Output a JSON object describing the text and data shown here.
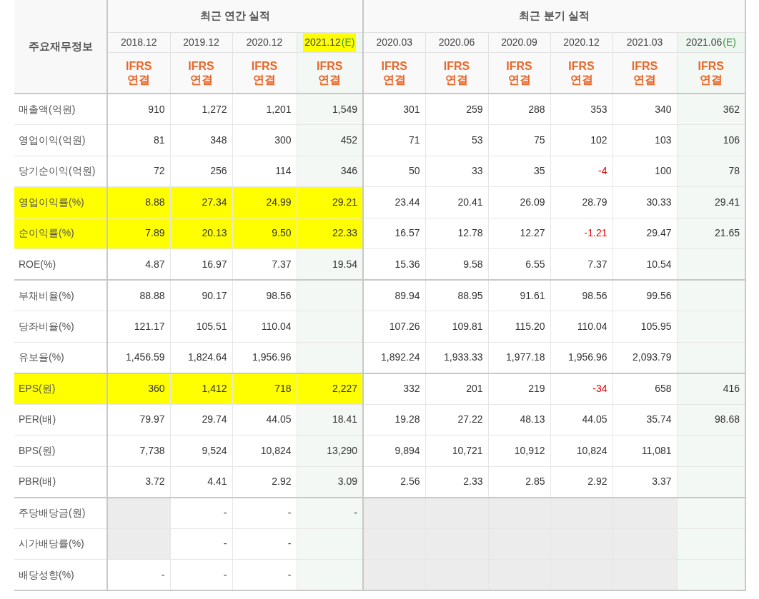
{
  "label_header": "주요재무정보",
  "groups": [
    {
      "title": "최근 연간 실적",
      "columns": [
        {
          "period": "2018.12",
          "highlighted": false,
          "basis": [
            "IFRS",
            "연결"
          ]
        },
        {
          "period": "2019.12",
          "highlighted": false,
          "basis": [
            "IFRS",
            "연결"
          ]
        },
        {
          "period": "2020.12",
          "highlighted": false,
          "basis": [
            "IFRS",
            "연결"
          ]
        },
        {
          "period": "2021.12",
          "estimate_mark": "(E)",
          "highlighted": true,
          "basis": [
            "IFRS",
            "연결"
          ]
        }
      ]
    },
    {
      "title": "최근 분기 실적",
      "columns": [
        {
          "period": "2020.03",
          "highlighted": false,
          "basis": [
            "IFRS",
            "연결"
          ]
        },
        {
          "period": "2020.06",
          "highlighted": false,
          "basis": [
            "IFRS",
            "연결"
          ]
        },
        {
          "period": "2020.09",
          "highlighted": false,
          "basis": [
            "IFRS",
            "연결"
          ]
        },
        {
          "period": "2020.12",
          "highlighted": false,
          "basis": [
            "IFRS",
            "연결"
          ]
        },
        {
          "period": "2021.03",
          "highlighted": false,
          "basis": [
            "IFRS",
            "연결"
          ]
        },
        {
          "period": "2021.06",
          "estimate_mark": "(E)",
          "highlighted": false,
          "basis": [
            "IFRS",
            "연결"
          ]
        }
      ]
    }
  ],
  "rows": [
    {
      "label": "매출액(억원)",
      "highlighted": false,
      "section_end": false,
      "values": [
        "910",
        "1,272",
        "1,201",
        "1,549",
        "301",
        "259",
        "288",
        "353",
        "340",
        "362"
      ]
    },
    {
      "label": "영업이익(억원)",
      "highlighted": false,
      "section_end": false,
      "values": [
        "81",
        "348",
        "300",
        "452",
        "71",
        "53",
        "75",
        "102",
        "103",
        "106"
      ]
    },
    {
      "label": "당기순이익(억원)",
      "highlighted": false,
      "section_end": false,
      "values": [
        "72",
        "256",
        "114",
        "346",
        "50",
        "33",
        "35",
        {
          "text": "-4",
          "negative": true
        },
        "100",
        "78"
      ]
    },
    {
      "label": "영업이익률(%)",
      "highlighted": true,
      "section_end": false,
      "values": [
        "8.88",
        "27.34",
        "24.99",
        "29.21",
        "23.44",
        "20.41",
        "26.09",
        "28.79",
        "30.33",
        "29.41"
      ]
    },
    {
      "label": "순이익률(%)",
      "highlighted": true,
      "section_end": false,
      "values": [
        "7.89",
        "20.13",
        "9.50",
        "22.33",
        "16.57",
        "12.78",
        "12.27",
        {
          "text": "-1.21",
          "negative": true
        },
        "29.47",
        "21.65"
      ]
    },
    {
      "label": "ROE(%)",
      "highlighted": false,
      "section_end": true,
      "values": [
        "4.87",
        "16.97",
        "7.37",
        "19.54",
        "15.36",
        "9.58",
        "6.55",
        "7.37",
        "10.54",
        {
          "shaded": false
        }
      ]
    },
    {
      "label": "부채비율(%)",
      "highlighted": false,
      "section_end": false,
      "values": [
        "88.88",
        "90.17",
        "98.56",
        {
          "shaded": false
        },
        "89.94",
        "88.95",
        "91.61",
        "98.56",
        "99.56",
        {
          "shaded": false
        }
      ]
    },
    {
      "label": "당좌비율(%)",
      "highlighted": false,
      "section_end": false,
      "values": [
        "121.17",
        "105.51",
        "110.04",
        {
          "shaded": false
        },
        "107.26",
        "109.81",
        "115.20",
        "110.04",
        "105.95",
        {
          "shaded": false
        }
      ]
    },
    {
      "label": "유보율(%)",
      "highlighted": false,
      "section_end": true,
      "values": [
        "1,456.59",
        "1,824.64",
        "1,956.96",
        {
          "shaded": false
        },
        "1,892.24",
        "1,933.33",
        "1,977.18",
        "1,956.96",
        "2,093.79",
        {
          "shaded": false
        }
      ]
    },
    {
      "label": "EPS(원)",
      "highlighted": true,
      "section_end": false,
      "values": [
        "360",
        "1,412",
        "718",
        "2,227",
        "332",
        "201",
        "219",
        {
          "text": "-34",
          "negative": true
        },
        "658",
        "416"
      ]
    },
    {
      "label": "PER(배)",
      "highlighted": false,
      "section_end": false,
      "values": [
        "79.97",
        "29.74",
        "44.05",
        "18.41",
        "19.28",
        "27.22",
        "48.13",
        "44.05",
        "35.74",
        "98.68"
      ]
    },
    {
      "label": "BPS(원)",
      "highlighted": false,
      "section_end": false,
      "values": [
        "7,738",
        "9,524",
        "10,824",
        "13,290",
        "9,894",
        "10,721",
        "10,912",
        "10,824",
        "11,081",
        {
          "shaded": false
        }
      ]
    },
    {
      "label": "PBR(배)",
      "highlighted": false,
      "section_end": true,
      "values": [
        "3.72",
        "4.41",
        "2.92",
        "3.09",
        "2.56",
        "2.33",
        "2.85",
        "2.92",
        "3.37",
        {
          "shaded": false
        }
      ]
    },
    {
      "label": "주당배당금(원)",
      "highlighted": false,
      "section_end": false,
      "values": [
        {
          "shaded": true
        },
        "-",
        "-",
        "-",
        {
          "shaded": true
        },
        {
          "shaded": true
        },
        {
          "shaded": true
        },
        {
          "shaded": true
        },
        {
          "shaded": true
        },
        {
          "shaded": false
        }
      ]
    },
    {
      "label": "시가배당률(%)",
      "highlighted": false,
      "section_end": false,
      "values": [
        {
          "shaded": true
        },
        "-",
        "-",
        {
          "shaded": false
        },
        {
          "shaded": true
        },
        {
          "shaded": true
        },
        {
          "shaded": true
        },
        {
          "shaded": true
        },
        {
          "shaded": true
        },
        {
          "shaded": false
        }
      ]
    },
    {
      "label": "배당성향(%)",
      "highlighted": false,
      "section_end": true,
      "values": [
        "-",
        "-",
        "-",
        {
          "shaded": false
        },
        {
          "shaded": true
        },
        {
          "shaded": true
        },
        {
          "shaded": true
        },
        {
          "shaded": true
        },
        {
          "shaded": true
        },
        {
          "shaded": false
        }
      ]
    }
  ]
}
